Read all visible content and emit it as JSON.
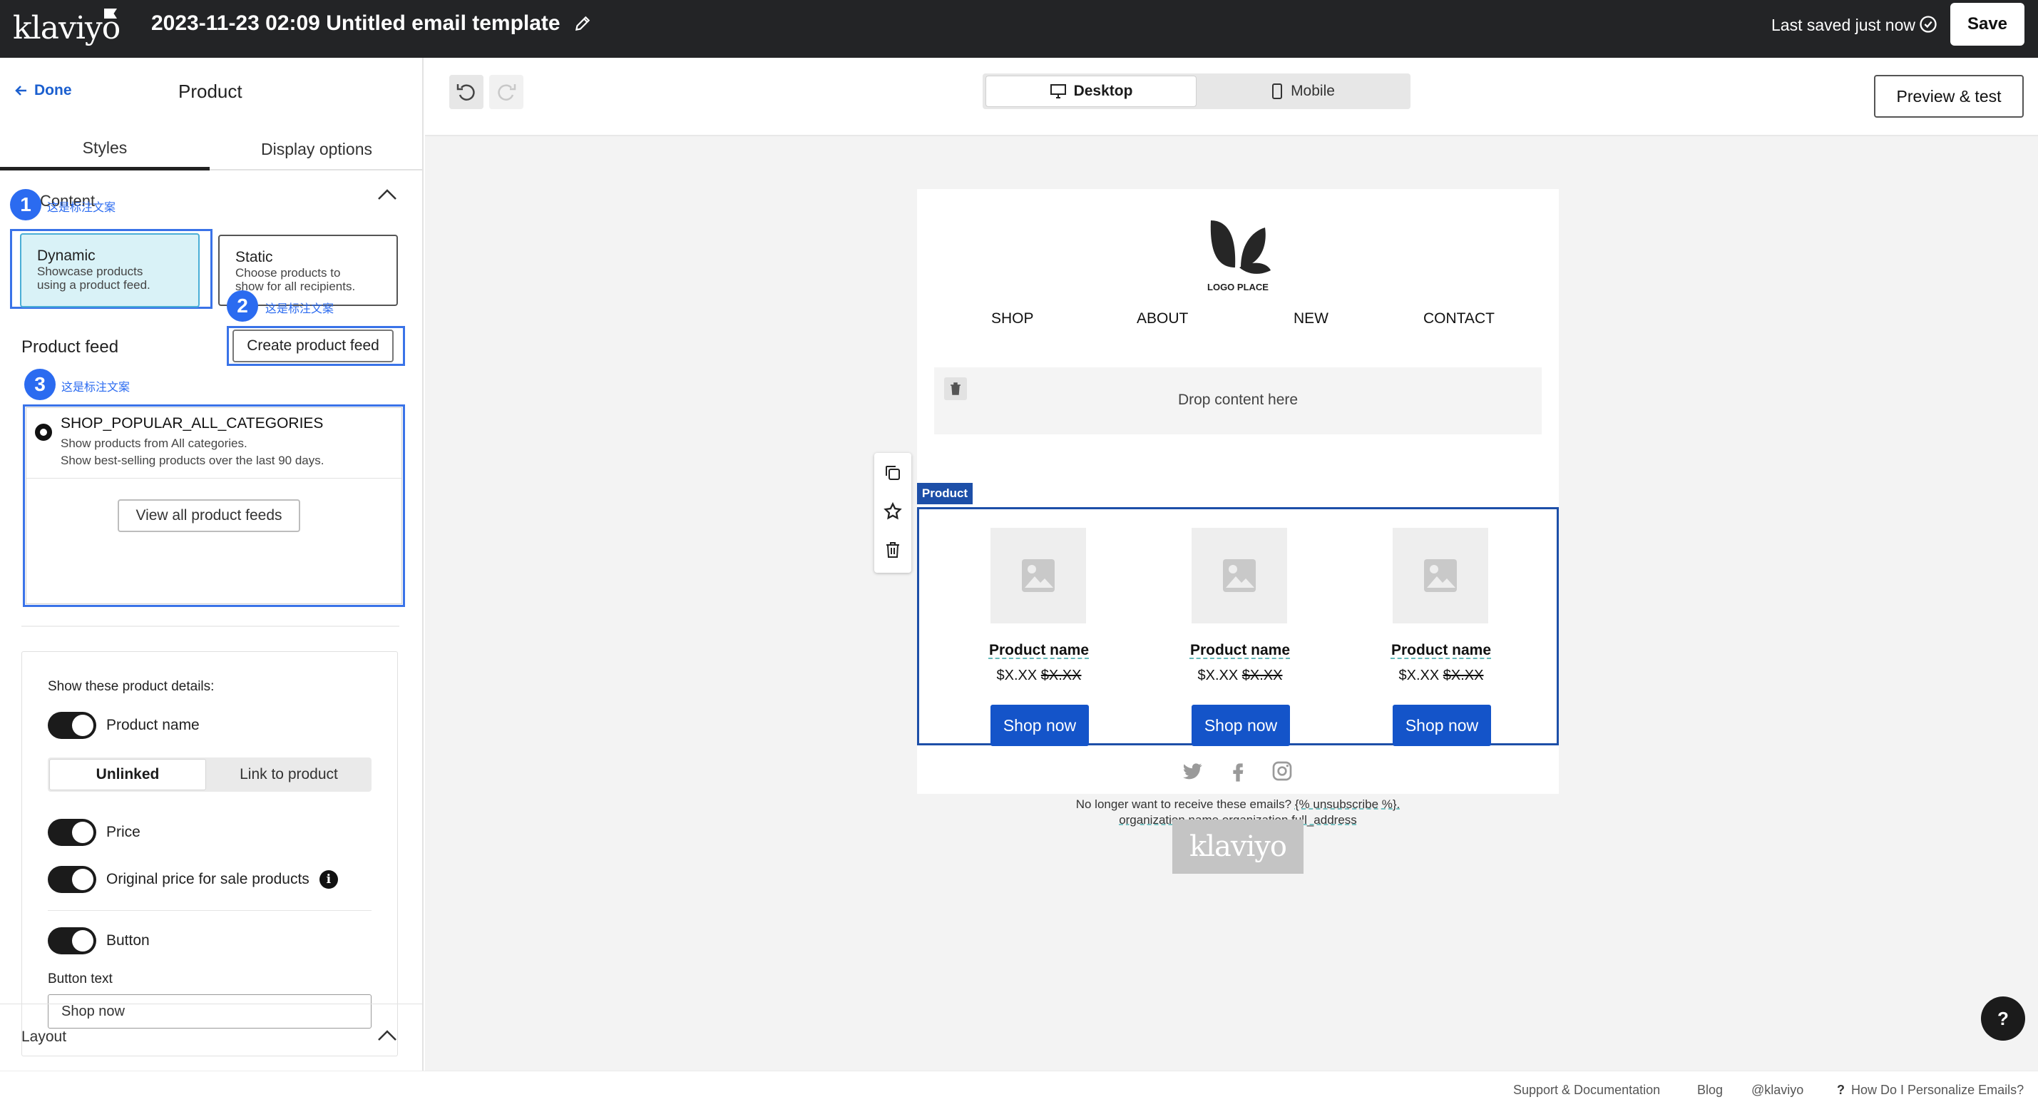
{
  "header": {
    "logo": "klaviyo",
    "title": "2023-11-23 02:09 Untitled email template",
    "saved_status": "Last saved just now",
    "save_label": "Save"
  },
  "sidebar": {
    "back_label": "Done",
    "panel_title": "Product",
    "tabs": [
      {
        "label": "Styles",
        "active": true
      },
      {
        "label": "Display options",
        "active": false
      }
    ],
    "content_section_label": "Content",
    "annotations": [
      {
        "number": "1",
        "text": "这是标注文案"
      },
      {
        "number": "2",
        "text": "这是标注文案"
      },
      {
        "number": "3",
        "text": "这是标注文案"
      }
    ],
    "content_types": [
      {
        "title": "Dynamic",
        "desc_line1": "Showcase products",
        "desc_line2": "using a product feed.",
        "selected": true
      },
      {
        "title": "Static",
        "desc_line1": "Choose products to",
        "desc_line2": "show for all recipients.",
        "selected": false
      }
    ],
    "product_feed_label": "Product feed",
    "create_feed_button": "Create product feed",
    "feed": {
      "name": "SHOP_POPULAR_ALL_CATEGORIES",
      "desc_line1": "Show products from All categories.",
      "desc_line2": "Show best-selling products over the last 90 days.",
      "selected": true
    },
    "view_all_button": "View all product feeds",
    "details": {
      "title": "Show these product details:",
      "product_name_toggle": "Product name",
      "link_options": [
        "Unlinked",
        "Link to product"
      ],
      "link_selected": "Unlinked",
      "price_toggle": "Price",
      "original_price_toggle": "Original price for sale products",
      "button_toggle": "Button",
      "button_text_label": "Button text",
      "button_text_value": "Shop now"
    },
    "layout_label": "Layout"
  },
  "canvas": {
    "device_options": [
      {
        "label": "Desktop",
        "active": true
      },
      {
        "label": "Mobile",
        "active": false
      }
    ],
    "preview_button": "Preview & test",
    "email": {
      "logo_text": "LOGO PLACE",
      "nav": [
        "SHOP",
        "ABOUT",
        "NEW",
        "CONTACT"
      ],
      "drop_text": "Drop content here",
      "product_tag": "Product",
      "products": [
        {
          "name": "Product name",
          "price": "$X.XX",
          "original_price": "$X.XX",
          "button": "Shop now"
        },
        {
          "name": "Product name",
          "price": "$X.XX",
          "original_price": "$X.XX",
          "button": "Shop now"
        },
        {
          "name": "Product name",
          "price": "$X.XX",
          "original_price": "$X.XX",
          "button": "Shop now"
        }
      ],
      "footer_line1_text": "No longer want to receive these emails?",
      "footer_unsubscribe": "{% unsubscribe %}.",
      "footer_line2": "organization.name organization.full_address",
      "badge": "klaviyo"
    },
    "help_label": "?"
  },
  "footer": {
    "links": [
      "Support & Documentation",
      "Blog",
      "@klaviyo",
      "How Do I Personalize Emails?"
    ]
  }
}
